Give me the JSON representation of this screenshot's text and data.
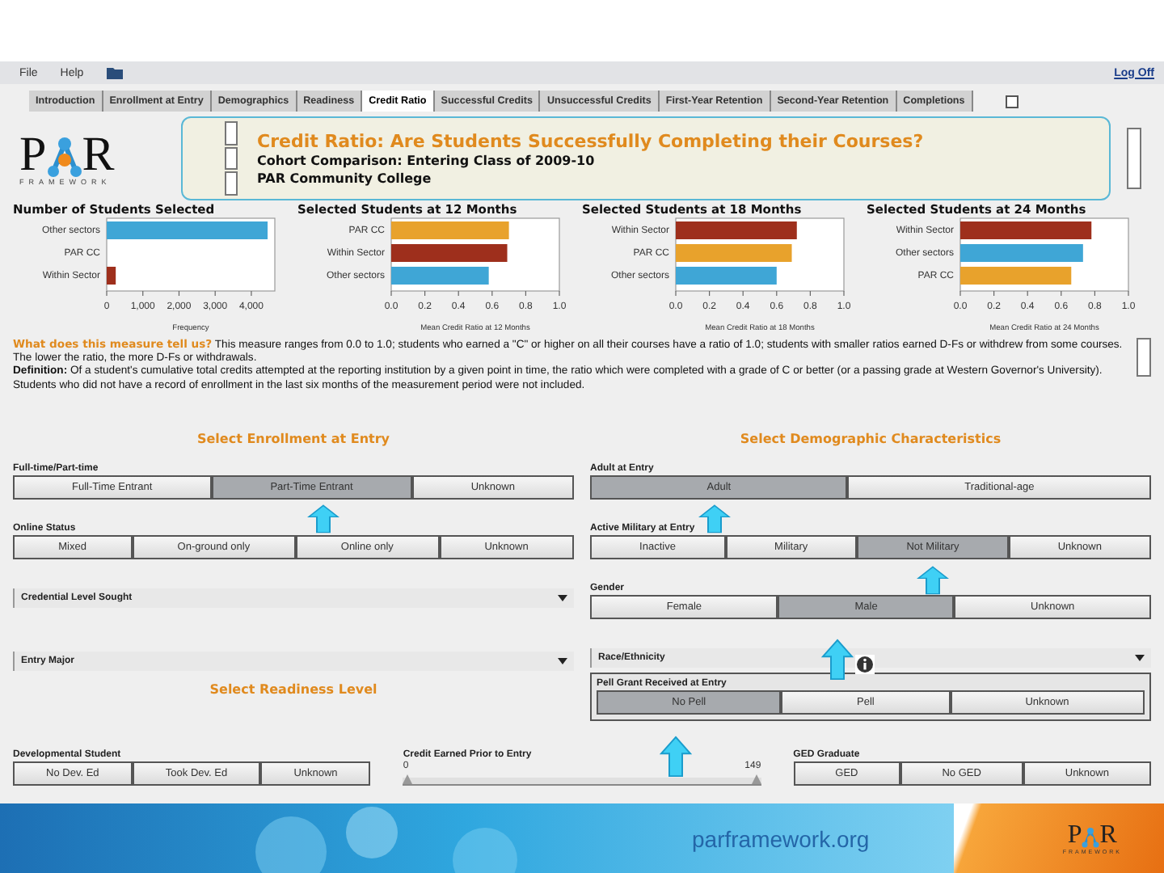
{
  "menu": {
    "items": [
      "File",
      "Help"
    ],
    "logoff": "Log Off"
  },
  "tabs": [
    {
      "label": "Introduction",
      "selected": false
    },
    {
      "label": "Enrollment at Entry",
      "selected": false
    },
    {
      "label": "Demographics",
      "selected": false
    },
    {
      "label": "Readiness",
      "selected": false
    },
    {
      "label": "Credit Ratio",
      "selected": true
    },
    {
      "label": "Successful Credits",
      "selected": false
    },
    {
      "label": "Unsuccessful Credits",
      "selected": false
    },
    {
      "label": "First-Year Retention",
      "selected": false
    },
    {
      "label": "Second-Year Retention",
      "selected": false
    },
    {
      "label": "Completions",
      "selected": false
    }
  ],
  "header": {
    "logo": {
      "letters": [
        "P",
        "R"
      ],
      "tagline": "FRAMEWORK"
    },
    "title": "Credit Ratio: Are Students Successfully Completing their Courses?",
    "subtitle": "Cohort Comparison: Entering Class of 2009-10",
    "college": "PAR Community College"
  },
  "charts": [
    {
      "chart_data": {
        "type": "bar",
        "orientation": "horizontal",
        "title": "Number of Students Selected",
        "xlabel": "Frequency",
        "categories": [
          "Other sectors",
          "PAR CC",
          "Within Sector"
        ],
        "colors": [
          "#3fa6d6",
          null,
          "#9e2f1c"
        ],
        "values": [
          4450,
          null,
          250
        ],
        "xlim": [
          0,
          4650
        ],
        "xticks": [
          {
            "value": 0,
            "label": "0"
          },
          {
            "value": 1000,
            "label": "1,000"
          },
          {
            "value": 2000,
            "label": "2,000"
          },
          {
            "value": 3000,
            "label": "3,000"
          },
          {
            "value": 4000,
            "label": "4,000"
          }
        ]
      }
    },
    {
      "chart_data": {
        "type": "bar",
        "orientation": "horizontal",
        "title": "Selected Students at 12 Months",
        "xlabel": "Mean Credit Ratio at 12 Months",
        "categories": [
          "PAR CC",
          "Within Sector",
          "Other sectors"
        ],
        "colors": [
          "#e8a22c",
          "#9e2f1c",
          "#3fa6d6"
        ],
        "values": [
          0.7,
          0.69,
          0.58
        ],
        "xlim": [
          0,
          1
        ],
        "xticks": [
          {
            "value": 0,
            "label": "0.0"
          },
          {
            "value": 0.2,
            "label": "0.2"
          },
          {
            "value": 0.4,
            "label": "0.4"
          },
          {
            "value": 0.6,
            "label": "0.6"
          },
          {
            "value": 0.8,
            "label": "0.8"
          },
          {
            "value": 1,
            "label": "1.0"
          }
        ]
      }
    },
    {
      "chart_data": {
        "type": "bar",
        "orientation": "horizontal",
        "title": "Selected Students at 18 Months",
        "xlabel": "Mean Credit Ratio at 18 Months",
        "categories": [
          "Within Sector",
          "PAR CC",
          "Other sectors"
        ],
        "colors": [
          "#9e2f1c",
          "#e8a22c",
          "#3fa6d6"
        ],
        "values": [
          0.72,
          0.69,
          0.6
        ],
        "xlim": [
          0,
          1
        ],
        "xticks": [
          {
            "value": 0,
            "label": "0.0"
          },
          {
            "value": 0.2,
            "label": "0.2"
          },
          {
            "value": 0.4,
            "label": "0.4"
          },
          {
            "value": 0.6,
            "label": "0.6"
          },
          {
            "value": 0.8,
            "label": "0.8"
          },
          {
            "value": 1,
            "label": "1.0"
          }
        ]
      }
    },
    {
      "chart_data": {
        "type": "bar",
        "orientation": "horizontal",
        "title": "Selected Students at 24 Months",
        "xlabel": "Mean Credit Ratio at 24 Months",
        "categories": [
          "Within Sector",
          "Other sectors",
          "PAR CC"
        ],
        "colors": [
          "#9e2f1c",
          "#3fa6d6",
          "#e8a22c"
        ],
        "values": [
          0.78,
          0.73,
          0.66
        ],
        "xlim": [
          0,
          1
        ],
        "xticks": [
          {
            "value": 0,
            "label": "0.0"
          },
          {
            "value": 0.2,
            "label": "0.2"
          },
          {
            "value": 0.4,
            "label": "0.4"
          },
          {
            "value": 0.6,
            "label": "0.6"
          },
          {
            "value": 0.8,
            "label": "0.8"
          },
          {
            "value": 1,
            "label": "1.0"
          }
        ]
      }
    }
  ],
  "description": [
    "**What does this measure tell us?** This measure ranges from 0.0 to 1.0; students who earned a \"C\" or higher on all their courses have a ratio of 1.0; students with smaller ratios earned D-Fs or withdrew from some courses.  The lower the ratio, the more D-Fs or withdrawals.",
    "**Definition:** Of a student's cumulative total credits attempted at the reporting institution by a given point in time, the ratio which were completed with a grade of C or better (or a passing grade at Western Governor's University). Students who did not have a record of enrollment in the last six months of the measurement period were not included."
  ],
  "filters": {
    "left": [
      {
        "kind": "heading",
        "label": "Select Enrollment at Entry"
      },
      {
        "kind": "buttons",
        "label": "Full-time/Part-time",
        "options": [
          {
            "label": "Full-Time Entrant",
            "selected": false
          },
          {
            "label": "Part-Time Entrant",
            "selected": true
          },
          {
            "label": "Unknown",
            "selected": false
          }
        ]
      },
      {
        "kind": "buttons",
        "label": "Online Status",
        "options": [
          {
            "label": "Mixed",
            "selected": false
          },
          {
            "label": "On-ground only",
            "selected": false
          },
          {
            "label": "Online only",
            "selected": false
          },
          {
            "label": "Unknown",
            "selected": false
          }
        ]
      },
      {
        "kind": "dropdown",
        "label": "Credential Level Sought"
      },
      {
        "kind": "dropdown",
        "label": "Entry Major"
      },
      {
        "kind": "heading",
        "label": "Select Readiness Level"
      }
    ],
    "right": [
      {
        "kind": "heading",
        "label": "Select Demographic Characteristics"
      },
      {
        "kind": "buttons",
        "label": "Adult at Entry",
        "options": [
          {
            "label": "Adult",
            "selected": true
          },
          {
            "label": "Traditional-age",
            "selected": false
          }
        ]
      },
      {
        "kind": "buttons",
        "label": "Active Military at Entry",
        "options": [
          {
            "label": "Inactive",
            "selected": false
          },
          {
            "label": "Military",
            "selected": false
          },
          {
            "label": "Not Military",
            "selected": true
          },
          {
            "label": "Unknown",
            "selected": false
          }
        ]
      },
      {
        "kind": "buttons",
        "label": "Gender",
        "options": [
          {
            "label": "Female",
            "selected": false
          },
          {
            "label": "Male",
            "selected": true
          },
          {
            "label": "Unknown",
            "selected": false
          }
        ]
      },
      {
        "kind": "dropdown",
        "label": "Race/Ethnicity"
      },
      {
        "kind": "framed",
        "label": "Pell Grant Received at Entry",
        "options": [
          {
            "label": "No Pell",
            "selected": true
          },
          {
            "label": "Pell",
            "selected": false
          },
          {
            "label": "Unknown",
            "selected": false
          }
        ]
      }
    ],
    "bottom": [
      {
        "kind": "buttons",
        "label": "Developmental Student",
        "options": [
          {
            "label": "No Dev. Ed",
            "selected": false
          },
          {
            "label": "Took Dev. Ed",
            "selected": false
          },
          {
            "label": "Unknown",
            "selected": false
          }
        ]
      },
      {
        "kind": "slider",
        "label": "Credit Earned Prior to Entry",
        "min": "0",
        "max": "149",
        "level": 1
      },
      {
        "kind": "buttons",
        "label": "GED Graduate",
        "options": [
          {
            "label": "GED",
            "selected": false
          },
          {
            "label": "No GED",
            "selected": false
          },
          {
            "label": "Unknown",
            "selected": false
          }
        ]
      }
    ]
  },
  "footer": {
    "site": "parframework.org",
    "logo": {
      "letters": [
        "P",
        "R"
      ],
      "tagline": "FRAMEWORK"
    }
  }
}
